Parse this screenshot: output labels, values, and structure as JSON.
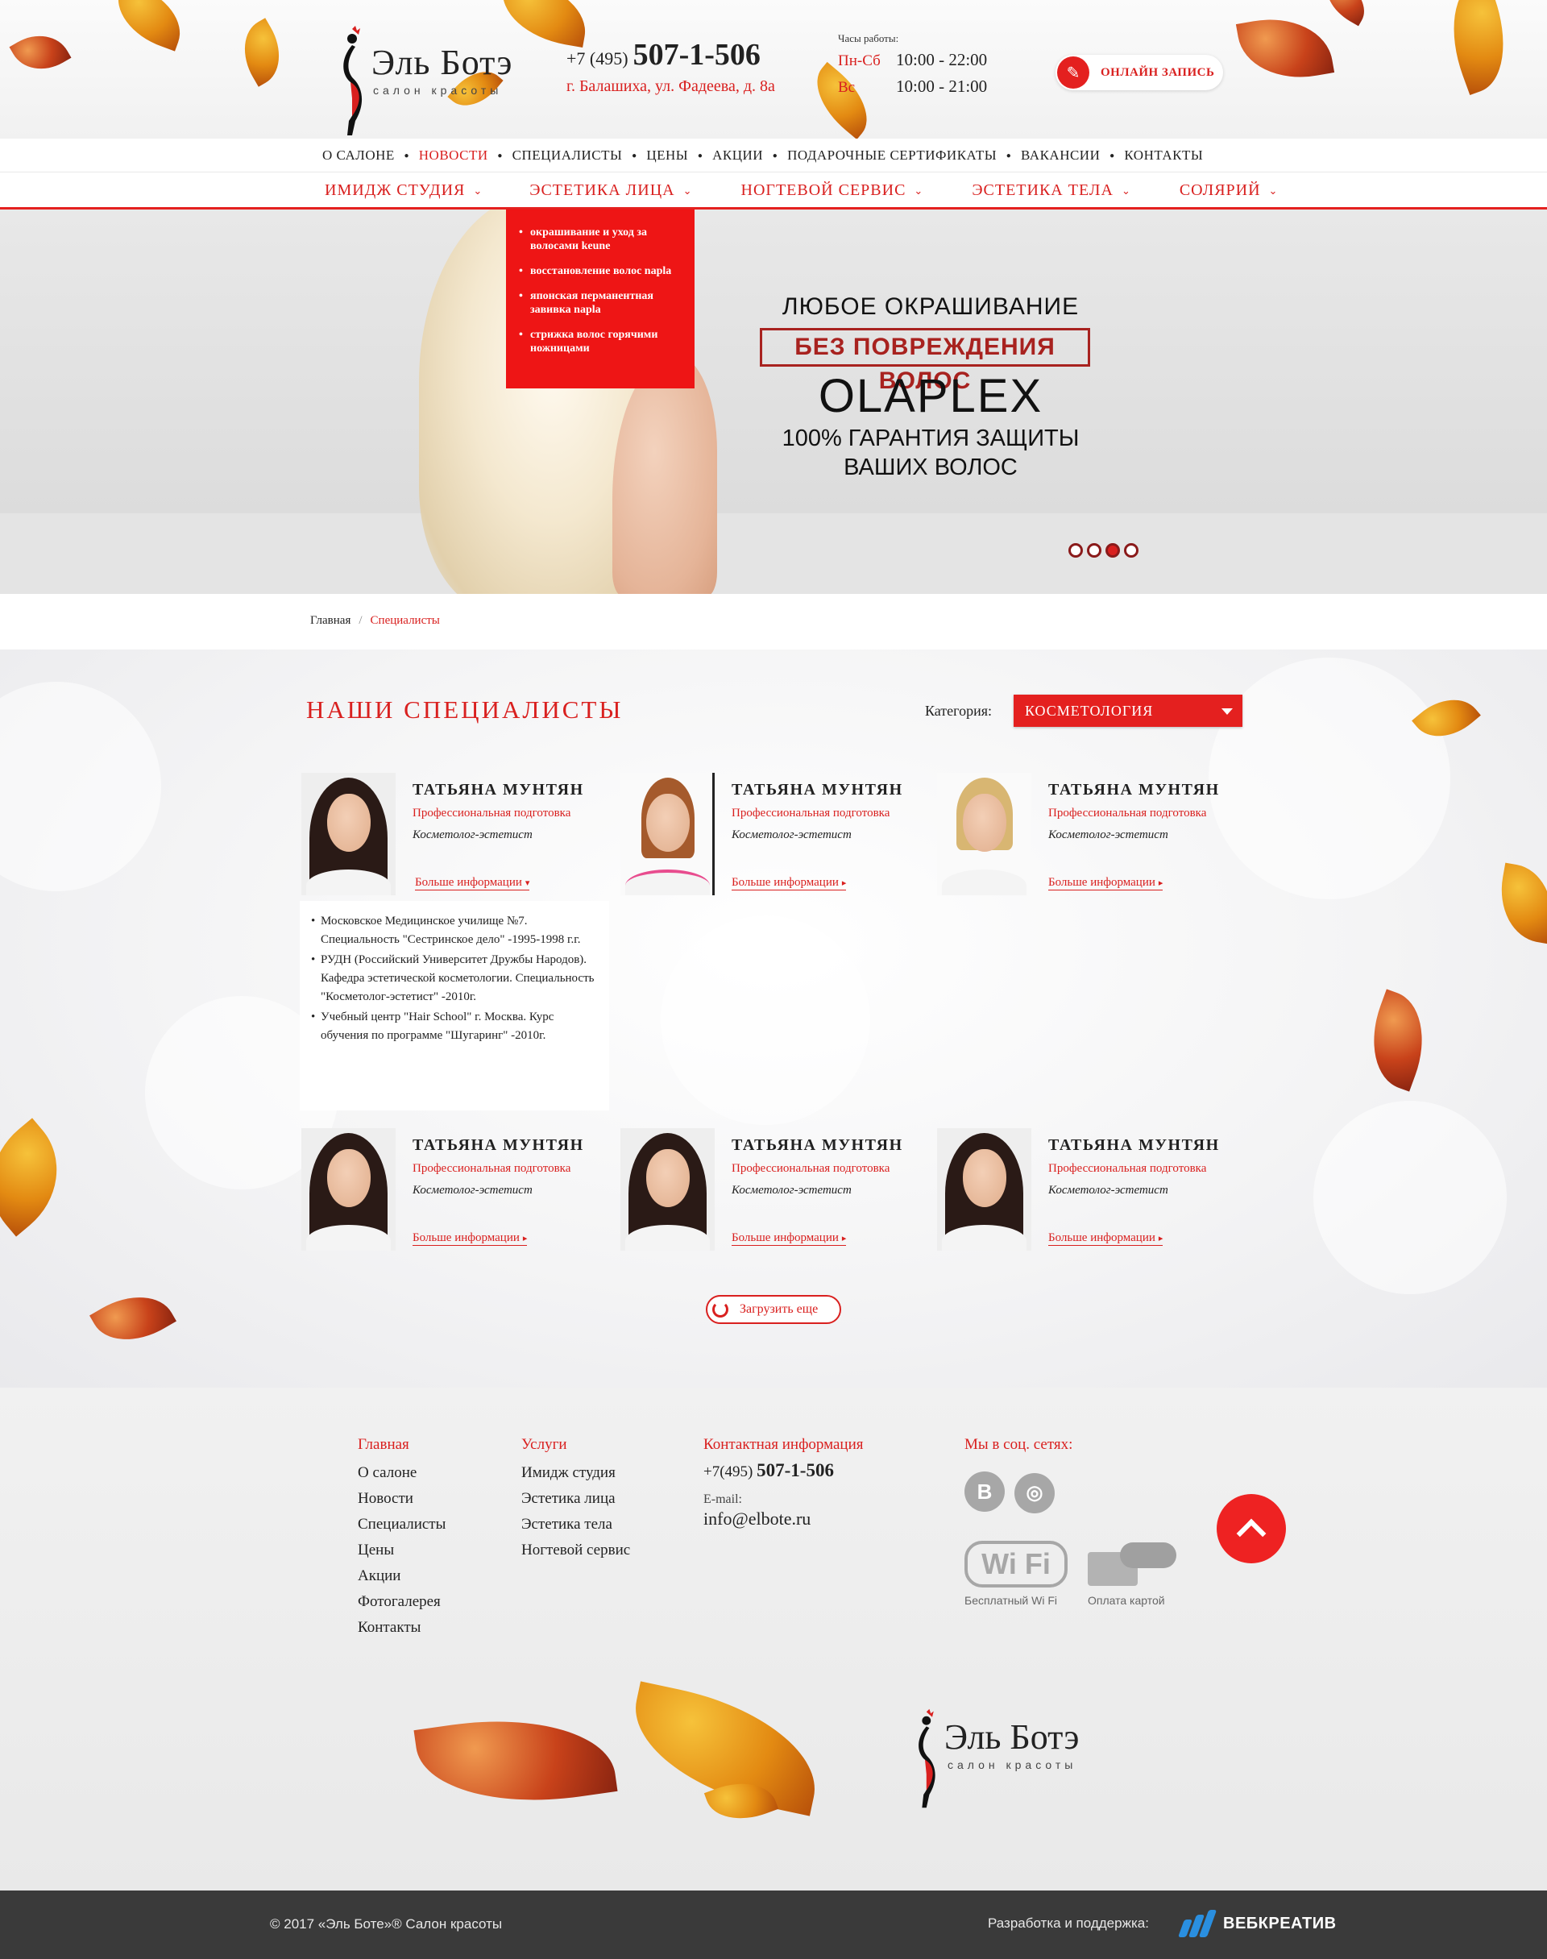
{
  "header": {
    "logo_name": "Эль Ботэ",
    "logo_sub": "салон красоты",
    "phone_code": "+7 (495)",
    "phone_number": "507-1-506",
    "address": "г. Балашиха, ул. Фадеева, д. 8а",
    "hours_title": "Часы работы:",
    "hours": [
      {
        "days": "Пн-Сб",
        "time": "10:00 - 22:00"
      },
      {
        "days": "Вс",
        "time": "10:00 - 21:00"
      }
    ],
    "online_label": "ОНЛАЙН ЗАПИСЬ"
  },
  "topnav": [
    "О САЛОНЕ",
    "НОВОСТИ",
    "СПЕЦИАЛИСТЫ",
    "ЦЕНЫ",
    "АКЦИИ",
    "ПОДАРОЧНЫЕ СЕРТИФИКАТЫ",
    "ВАКАНСИИ",
    "КОНТАКТЫ"
  ],
  "servnav": [
    "ИМИДЖ СТУДИЯ",
    "ЭСТЕТИКА ЛИЦА",
    "НОГТЕВОЙ СЕРВИС",
    "ЭСТЕТИКА ТЕЛА",
    "СОЛЯРИЙ"
  ],
  "dropdown": [
    "окрашивание и уход за волосами keune",
    "восстановление волос napla",
    "японская перманентная завивка napla",
    "стрижка волос горячими ножницами"
  ],
  "hero": {
    "line1": "ЛЮБОЕ ОКРАШИВАНИЕ",
    "stamp": "БЕЗ ПОВРЕЖДЕНИЯ ВОЛОС",
    "brand": "OLAPLEX",
    "line3": "100% ГАРАНТИЯ ЗАЩИТЫ",
    "line4": "ВАШИХ ВОЛОС",
    "slides_total": 4,
    "slide_active": 3
  },
  "breadcrumb": {
    "home": "Главная",
    "sep": "/",
    "current": "Специалисты"
  },
  "specialists": {
    "title": "НАШИ СПЕЦИАЛИСТЫ",
    "category_label": "Категория:",
    "category_value": "КОСМЕТОЛОГИЯ",
    "cards": [
      {
        "name": "ТАТЬЯНА МУНТЯН",
        "prep": "Профессиональная подготовка",
        "role": "Косметолог-эстетист",
        "more": "Больше информации",
        "more_icon": "▾"
      },
      {
        "name": "ТАТЬЯНА МУНТЯН",
        "prep": "Профессиональная подготовка",
        "role": "Косметолог-эстетист",
        "more": "Больше информации",
        "more_icon": "▸"
      },
      {
        "name": "ТАТЬЯНА МУНТЯН",
        "prep": "Профессиональная подготовка",
        "role": "Косметолог-эстетист",
        "more": "Больше информации",
        "more_icon": "▸"
      },
      {
        "name": "ТАТЬЯНА МУНТЯН",
        "prep": "Профессиональная подготовка",
        "role": "Косметолог-эстетист",
        "more": "Больше информации",
        "more_icon": "▸"
      },
      {
        "name": "ТАТЬЯНА МУНТЯН",
        "prep": "Профессиональная подготовка",
        "role": "Косметолог-эстетист",
        "more": "Больше информации",
        "more_icon": "▸"
      },
      {
        "name": "ТАТЬЯНА МУНТЯН",
        "prep": "Профессиональная подготовка",
        "role": "Косметолог-эстетист",
        "more": "Больше информации",
        "more_icon": "▸"
      }
    ],
    "bio": [
      "Московское Медицинское училище №7. Специальность \"Сестринское дело\" -1995-1998 г.г.",
      "РУДН (Российский Университет Дружбы Народов). Кафедра эстетической косметологии. Специальность \"Косметолог-эстетист\" -2010г.",
      "Учебный центр \"Hair School\" г. Москва. Курс обучения по программе \"Шугаринг\" -2010г."
    ],
    "load_more": "Загрузить еще"
  },
  "footer": {
    "col1": {
      "head": "Главная",
      "items": [
        "О салоне",
        "Новости",
        "Специалисты",
        "Цены",
        "Акции",
        "Фотогалерея",
        "Контакты"
      ]
    },
    "col2": {
      "head": "Услуги",
      "items": [
        "Имидж студия",
        "Эстетика лица",
        "Эстетика тела",
        "Ногтевой сервис"
      ]
    },
    "col3": {
      "head": "Контактная информация",
      "phone_code": "+7(495)",
      "phone_number": "507-1-506",
      "email_label": "E-mail:",
      "email": "info@elbote.ru"
    },
    "col4": {
      "head": "Мы в соц. сетях:",
      "vk": "В",
      "wifi": "Wi Fi",
      "wifi_caption": "Бесплатный Wi Fi",
      "card_caption": "Оплата картой"
    },
    "logo_name": "Эль Ботэ",
    "logo_sub": "салон красоты"
  },
  "bottom": {
    "copyright": "© 2017 «Эль Боте»® Салон красоты",
    "dev_label": "Разработка и поддержка:",
    "dev_name": "ВЕБКРЕАТИВ"
  },
  "colors": {
    "accent": "#e4201f",
    "dark": "#3a3a3a"
  }
}
